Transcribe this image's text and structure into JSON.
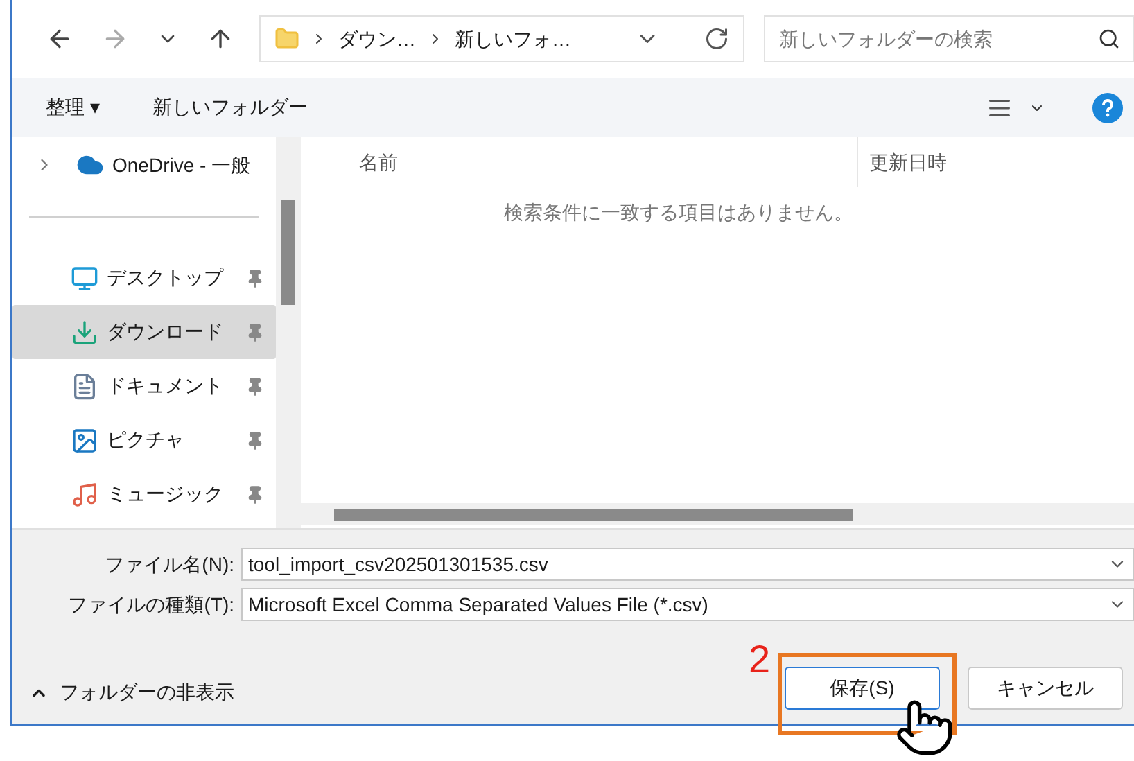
{
  "nav": {
    "breadcrumb": [
      "ダウン…",
      "新しいフォ…"
    ],
    "search_placeholder": "新しいフォルダーの検索"
  },
  "toolbar": {
    "organize": "整理 ▾",
    "new_folder": "新しいフォルダー"
  },
  "sidebar": {
    "root": {
      "label": "OneDrive - 一般",
      "expanded": false
    },
    "items": [
      {
        "kind": "desktop",
        "label": "デスクトップ",
        "selected": false
      },
      {
        "kind": "download",
        "label": "ダウンロード",
        "selected": true
      },
      {
        "kind": "document",
        "label": "ドキュメント",
        "selected": false
      },
      {
        "kind": "picture",
        "label": "ピクチャ",
        "selected": false
      },
      {
        "kind": "music",
        "label": "ミュージック",
        "selected": false
      }
    ]
  },
  "table": {
    "columns": [
      "名前",
      "更新日時"
    ],
    "empty_message": "検索条件に一致する項目はありません。"
  },
  "fields": [
    {
      "label": "ファイル名(N):",
      "value": "tool_import_csv202501301535.csv"
    },
    {
      "label": "ファイルの種類(T):",
      "value": "Microsoft Excel Comma Separated Values File (*.csv)"
    }
  ],
  "footer": {
    "toggle": "フォルダーの非表示",
    "buttons": [
      {
        "kind": "primary",
        "label": "保存(S)"
      },
      {
        "kind": "normal",
        "label": "キャンセル"
      }
    ]
  },
  "annotation": {
    "step": "2"
  }
}
